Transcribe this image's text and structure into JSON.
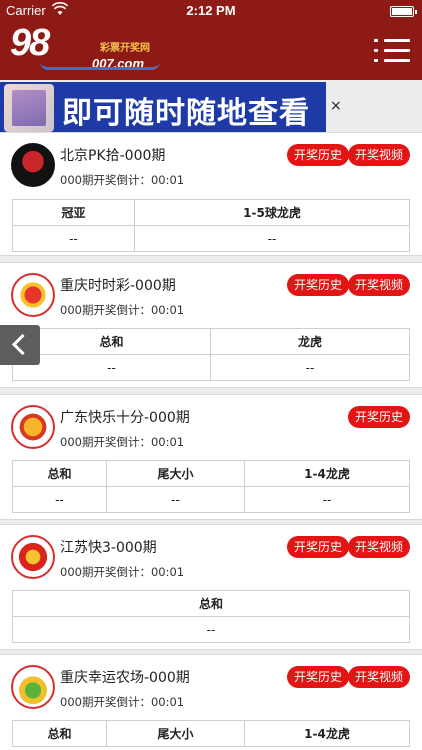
{
  "statusbar": {
    "carrier": "Carrier",
    "time": "2:12 PM"
  },
  "header": {
    "logo_number": "98",
    "logo_site": "007.com",
    "logo_tag": "彩票开奖网"
  },
  "banner": {
    "text": "即可随时随地查看",
    "close": "×"
  },
  "buttons": {
    "history": "开奖历史",
    "video": "开奖视频"
  },
  "cards": [
    {
      "name": "北京PK拾-000期",
      "countdown": "000期开奖倒计：00:01",
      "icon": "pk10-logo-icon",
      "columns": [
        "冠亚",
        "1-5球龙虎"
      ],
      "values": [
        "--",
        "--"
      ]
    },
    {
      "name": "重庆时时彩-000期",
      "countdown": "000期开奖倒计：00:01",
      "icon": "shishicai-logo-icon",
      "columns": [
        "总和",
        "龙虎"
      ],
      "values": [
        "--",
        "--"
      ]
    },
    {
      "name": "广东快乐十分-000期",
      "countdown": "000期开奖倒计：00:01",
      "icon": "kuaile10-logo-icon",
      "columns": [
        "总和",
        "尾大小",
        "1-4龙虎"
      ],
      "values": [
        "--",
        "--",
        "--"
      ]
    },
    {
      "name": "江苏快3-000期",
      "countdown": "000期开奖倒计：00:01",
      "icon": "kuai3-logo-icon",
      "columns": [
        "总和"
      ],
      "values": [
        "--"
      ]
    },
    {
      "name": "重庆幸运农场-000期",
      "countdown": "000期开奖倒计：00:01",
      "icon": "xingyun-farm-logo-icon",
      "columns": [
        "总和",
        "尾大小",
        "1-4龙虎"
      ],
      "values": []
    }
  ],
  "colors": {
    "brand": "#8e1a16",
    "button": "#e21414",
    "banner": "#1e3aa6"
  }
}
